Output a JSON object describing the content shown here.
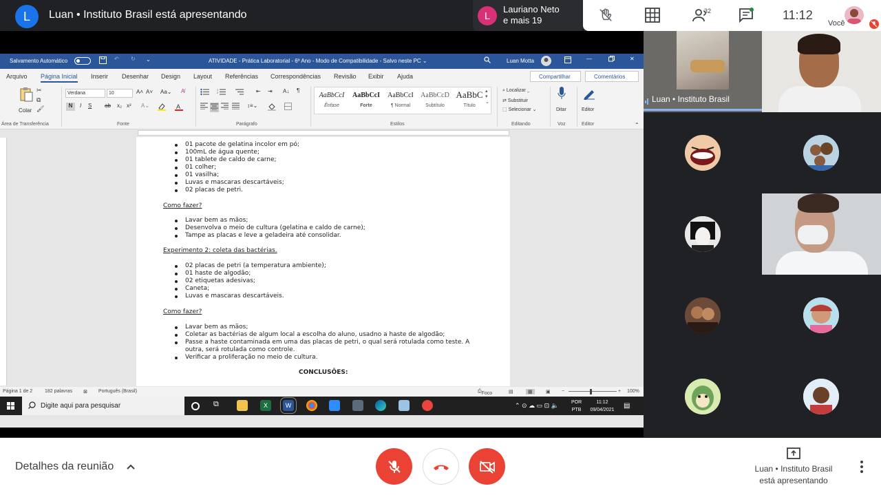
{
  "meet": {
    "presenter_initial": "L",
    "presenter_title": "Luan • Instituto Brasil está apresentando",
    "chip": {
      "initial": "L",
      "line1": "Lauriano Neto",
      "line2": "e mais 19"
    },
    "participants_count": "32",
    "clock": "11:12",
    "self_label": "Você",
    "meeting_details": "Detalhes da reunião",
    "presenting_line1": "Luan • Instituto Brasil",
    "presenting_line2": "está apresentando",
    "speaker_label": "Luan • Instituto Brasil",
    "colors": {
      "end_call": "#ea4335",
      "active": "#8ab4f8",
      "accent": "#1a73e8"
    }
  },
  "word": {
    "autosave": "Salvamento Automático",
    "title": "ATIVIDADE - Prática Laboratorial - 6º Ano  -  Modo de Compatibilidade  -  Salvo neste PC  ⌄",
    "user": "Luan Motta",
    "tabs": [
      "Arquivo",
      "Página Inicial",
      "Inserir",
      "Desenhar",
      "Design",
      "Layout",
      "Referências",
      "Correspondências",
      "Revisão",
      "Exibir",
      "Ajuda"
    ],
    "share": "Compartilhar",
    "comments": "Comentários",
    "font_name": "Verdana",
    "font_size": "10",
    "paste": "Colar",
    "styles": [
      {
        "sample": "AaBbCcI",
        "label": "Ênfase"
      },
      {
        "sample": "AaBbCcI",
        "label": "Forte"
      },
      {
        "sample": "AaBbCcI",
        "label": "¶ Normal"
      },
      {
        "sample": "AaBbCcD",
        "label": "Subtítulo"
      },
      {
        "sample": "AaBbC",
        "label": "Título"
      }
    ],
    "editing": {
      "find": "Localizar",
      "replace": "Substituir",
      "select": "Selecionar"
    },
    "dictate": "Ditar",
    "editor": "Editor",
    "groups": [
      "Área de Transferência",
      "Fonte",
      "Parágrafo",
      "Estilos",
      "Editando",
      "Voz",
      "Editor"
    ],
    "status": {
      "page": "Página 1 de 2",
      "words": "182 palavras",
      "lang": "Português (Brasil)",
      "focus": "Foco",
      "zoom": "100%"
    },
    "taskbar": {
      "search_placeholder": "Digite aqui para pesquisar",
      "lang1": "POR",
      "lang2": "PTB",
      "time": "11:12",
      "date": "09/04/2021"
    }
  },
  "doc": {
    "list1": [
      "01 pacote de gelatina incolor em pó;",
      "100mL de água quente;",
      "01 tablete de caldo de carne;",
      "01 colher;",
      "01 vasilha;",
      "Luvas e mascaras descartáveis;",
      "02 placas de petri."
    ],
    "heading1": "Como fazer?",
    "list2": [
      "Lavar bem as mãos;",
      "Desenvolva o meio de cultura (gelatina e caldo de carne);",
      "Tampe as placas e leve a geladeira até consolidar."
    ],
    "heading2": "Experimento 2: coleta das bactérias.",
    "list3": [
      "02 placas de petri (a temperatura ambiente);",
      "01 haste de algodão;",
      "02 etiquetas adesivas;",
      "Caneta;",
      "Luvas e mascaras descartáveis."
    ],
    "heading3": "Como fazer?",
    "list4": [
      "Lavar bem as mãos;",
      "Coletar as bactérias de algum local a escolha do aluno, usadno a haste de algodão;",
      "Passe a haste contaminada em uma das placas de petri, o qual será rotulada como teste. A",
      "outra, será rotulada como controle.",
      "Verificar a proliferação no meio de cultura."
    ],
    "conclusion": "CONCLUSÕES:"
  }
}
